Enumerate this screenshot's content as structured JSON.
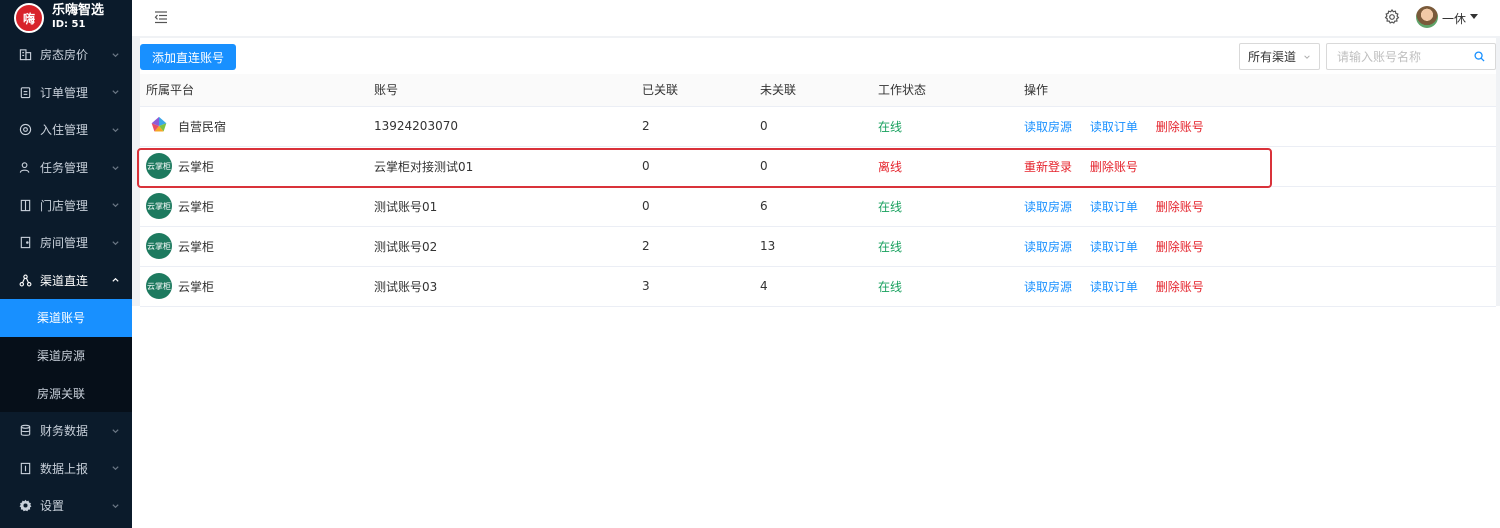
{
  "brand": {
    "name": "乐嗨智选",
    "id_label": "ID: 51",
    "logo_text": "嗨"
  },
  "sidebar": {
    "items": [
      {
        "label": "房态房价",
        "icon": "building-icon"
      },
      {
        "label": "订单管理",
        "icon": "clipboard-icon"
      },
      {
        "label": "入住管理",
        "icon": "checkin-icon"
      },
      {
        "label": "任务管理",
        "icon": "task-user-icon"
      },
      {
        "label": "门店管理",
        "icon": "door-icon"
      },
      {
        "label": "房间管理",
        "icon": "room-icon"
      },
      {
        "label": "渠道直连",
        "icon": "share-icon",
        "expanded": true
      },
      {
        "label": "财务数据",
        "icon": "database-icon"
      },
      {
        "label": "数据上报",
        "icon": "report-icon"
      },
      {
        "label": "设置",
        "icon": "settings-icon"
      }
    ],
    "sub_items": [
      {
        "label": "渠道账号",
        "active": true
      },
      {
        "label": "渠道房源",
        "active": false
      },
      {
        "label": "房源关联",
        "active": false
      }
    ]
  },
  "header": {
    "user_name": "一休"
  },
  "toolbar": {
    "add_label": "添加直连账号",
    "channel_select": "所有渠道",
    "search_placeholder": "请输入账号名称"
  },
  "table": {
    "columns": [
      "所属平台",
      "账号",
      "已关联",
      "未关联",
      "工作状态",
      "操作"
    ],
    "rows": [
      {
        "platform": "自营民宿",
        "platform_icon": "self-run-logo",
        "account": "13924203070",
        "linked": "2",
        "unlinked": "0",
        "status": "在线",
        "online": true,
        "ops": [
          "读取房源",
          "读取订单",
          "删除账号"
        ]
      },
      {
        "platform": "云掌柜",
        "platform_icon": "yunzhanggui-logo",
        "account": "云掌柜对接测试01",
        "linked": "0",
        "unlinked": "0",
        "status": "离线",
        "online": false,
        "ops": [
          "重新登录",
          "删除账号"
        ]
      },
      {
        "platform": "云掌柜",
        "platform_icon": "yunzhanggui-logo",
        "account": "测试账号01",
        "linked": "0",
        "unlinked": "6",
        "status": "在线",
        "online": true,
        "ops": [
          "读取房源",
          "读取订单",
          "删除账号"
        ]
      },
      {
        "platform": "云掌柜",
        "platform_icon": "yunzhanggui-logo",
        "account": "测试账号02",
        "linked": "2",
        "unlinked": "13",
        "status": "在线",
        "online": true,
        "ops": [
          "读取房源",
          "读取订单",
          "删除账号"
        ]
      },
      {
        "platform": "云掌柜",
        "platform_icon": "yunzhanggui-logo",
        "account": "测试账号03",
        "linked": "3",
        "unlinked": "4",
        "status": "在线",
        "online": true,
        "ops": [
          "读取房源",
          "读取订单",
          "删除账号"
        ]
      }
    ]
  },
  "icon_text": {
    "yunzhanggui": "云掌柜"
  },
  "colors": {
    "primary": "#1890ff",
    "online": "#19a15f",
    "danger": "#e5242d",
    "sidebar_bg": "#0b1b2b"
  }
}
